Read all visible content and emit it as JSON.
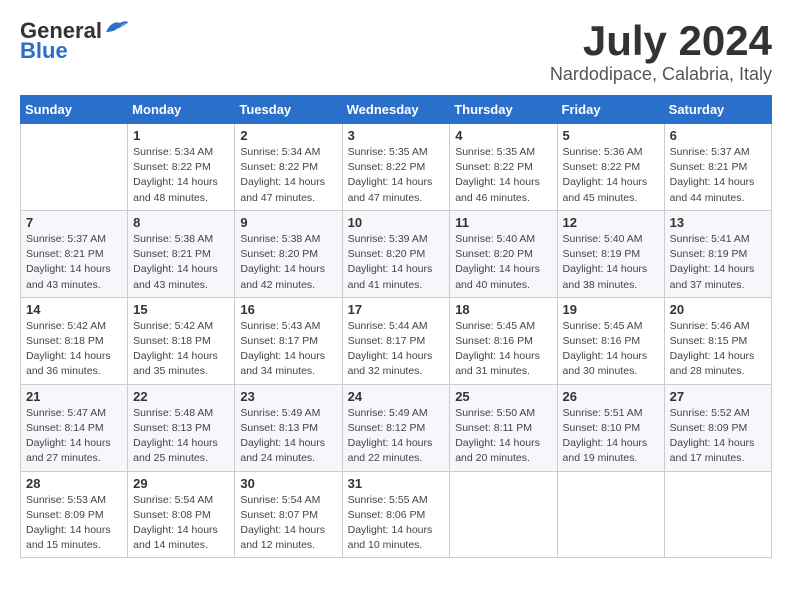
{
  "header": {
    "logo": {
      "general": "General",
      "blue": "Blue"
    },
    "title": "July 2024",
    "location": "Nardodipace, Calabria, Italy"
  },
  "calendar": {
    "headers": [
      "Sunday",
      "Monday",
      "Tuesday",
      "Wednesday",
      "Thursday",
      "Friday",
      "Saturday"
    ],
    "weeks": [
      [
        {
          "day": "",
          "info": ""
        },
        {
          "day": "1",
          "info": "Sunrise: 5:34 AM\nSunset: 8:22 PM\nDaylight: 14 hours\nand 48 minutes."
        },
        {
          "day": "2",
          "info": "Sunrise: 5:34 AM\nSunset: 8:22 PM\nDaylight: 14 hours\nand 47 minutes."
        },
        {
          "day": "3",
          "info": "Sunrise: 5:35 AM\nSunset: 8:22 PM\nDaylight: 14 hours\nand 47 minutes."
        },
        {
          "day": "4",
          "info": "Sunrise: 5:35 AM\nSunset: 8:22 PM\nDaylight: 14 hours\nand 46 minutes."
        },
        {
          "day": "5",
          "info": "Sunrise: 5:36 AM\nSunset: 8:22 PM\nDaylight: 14 hours\nand 45 minutes."
        },
        {
          "day": "6",
          "info": "Sunrise: 5:37 AM\nSunset: 8:21 PM\nDaylight: 14 hours\nand 44 minutes."
        }
      ],
      [
        {
          "day": "7",
          "info": "Sunrise: 5:37 AM\nSunset: 8:21 PM\nDaylight: 14 hours\nand 43 minutes."
        },
        {
          "day": "8",
          "info": "Sunrise: 5:38 AM\nSunset: 8:21 PM\nDaylight: 14 hours\nand 43 minutes."
        },
        {
          "day": "9",
          "info": "Sunrise: 5:38 AM\nSunset: 8:20 PM\nDaylight: 14 hours\nand 42 minutes."
        },
        {
          "day": "10",
          "info": "Sunrise: 5:39 AM\nSunset: 8:20 PM\nDaylight: 14 hours\nand 41 minutes."
        },
        {
          "day": "11",
          "info": "Sunrise: 5:40 AM\nSunset: 8:20 PM\nDaylight: 14 hours\nand 40 minutes."
        },
        {
          "day": "12",
          "info": "Sunrise: 5:40 AM\nSunset: 8:19 PM\nDaylight: 14 hours\nand 38 minutes."
        },
        {
          "day": "13",
          "info": "Sunrise: 5:41 AM\nSunset: 8:19 PM\nDaylight: 14 hours\nand 37 minutes."
        }
      ],
      [
        {
          "day": "14",
          "info": "Sunrise: 5:42 AM\nSunset: 8:18 PM\nDaylight: 14 hours\nand 36 minutes."
        },
        {
          "day": "15",
          "info": "Sunrise: 5:42 AM\nSunset: 8:18 PM\nDaylight: 14 hours\nand 35 minutes."
        },
        {
          "day": "16",
          "info": "Sunrise: 5:43 AM\nSunset: 8:17 PM\nDaylight: 14 hours\nand 34 minutes."
        },
        {
          "day": "17",
          "info": "Sunrise: 5:44 AM\nSunset: 8:17 PM\nDaylight: 14 hours\nand 32 minutes."
        },
        {
          "day": "18",
          "info": "Sunrise: 5:45 AM\nSunset: 8:16 PM\nDaylight: 14 hours\nand 31 minutes."
        },
        {
          "day": "19",
          "info": "Sunrise: 5:45 AM\nSunset: 8:16 PM\nDaylight: 14 hours\nand 30 minutes."
        },
        {
          "day": "20",
          "info": "Sunrise: 5:46 AM\nSunset: 8:15 PM\nDaylight: 14 hours\nand 28 minutes."
        }
      ],
      [
        {
          "day": "21",
          "info": "Sunrise: 5:47 AM\nSunset: 8:14 PM\nDaylight: 14 hours\nand 27 minutes."
        },
        {
          "day": "22",
          "info": "Sunrise: 5:48 AM\nSunset: 8:13 PM\nDaylight: 14 hours\nand 25 minutes."
        },
        {
          "day": "23",
          "info": "Sunrise: 5:49 AM\nSunset: 8:13 PM\nDaylight: 14 hours\nand 24 minutes."
        },
        {
          "day": "24",
          "info": "Sunrise: 5:49 AM\nSunset: 8:12 PM\nDaylight: 14 hours\nand 22 minutes."
        },
        {
          "day": "25",
          "info": "Sunrise: 5:50 AM\nSunset: 8:11 PM\nDaylight: 14 hours\nand 20 minutes."
        },
        {
          "day": "26",
          "info": "Sunrise: 5:51 AM\nSunset: 8:10 PM\nDaylight: 14 hours\nand 19 minutes."
        },
        {
          "day": "27",
          "info": "Sunrise: 5:52 AM\nSunset: 8:09 PM\nDaylight: 14 hours\nand 17 minutes."
        }
      ],
      [
        {
          "day": "28",
          "info": "Sunrise: 5:53 AM\nSunset: 8:09 PM\nDaylight: 14 hours\nand 15 minutes."
        },
        {
          "day": "29",
          "info": "Sunrise: 5:54 AM\nSunset: 8:08 PM\nDaylight: 14 hours\nand 14 minutes."
        },
        {
          "day": "30",
          "info": "Sunrise: 5:54 AM\nSunset: 8:07 PM\nDaylight: 14 hours\nand 12 minutes."
        },
        {
          "day": "31",
          "info": "Sunrise: 5:55 AM\nSunset: 8:06 PM\nDaylight: 14 hours\nand 10 minutes."
        },
        {
          "day": "",
          "info": ""
        },
        {
          "day": "",
          "info": ""
        },
        {
          "day": "",
          "info": ""
        }
      ]
    ]
  }
}
